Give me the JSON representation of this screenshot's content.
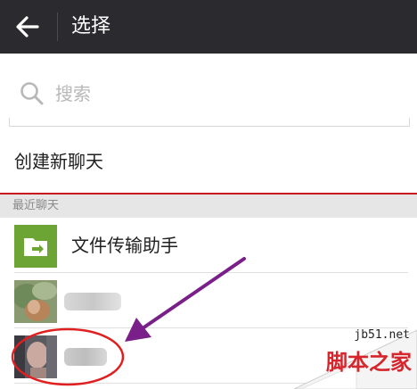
{
  "header": {
    "title": "选择",
    "back_icon": "arrow-left-icon"
  },
  "search": {
    "placeholder": "搜索",
    "icon": "search-icon"
  },
  "actions": {
    "new_chat_label": "创建新聊天"
  },
  "recent": {
    "section_label": "最近聊天",
    "items": [
      {
        "label": "文件传输助手",
        "icon": "file-transfer-icon"
      },
      {
        "label": "",
        "icon": "avatar"
      },
      {
        "label": "",
        "icon": "avatar"
      }
    ]
  },
  "watermark": {
    "url": "jb51.net",
    "name": "脚本之家"
  },
  "colors": {
    "header_bg": "#2b2b2f",
    "accent_line": "#c8141e",
    "file_icon_green": "#6da534",
    "annotation_arrow": "#7a1f8a",
    "annotation_circle": "#e02020"
  }
}
